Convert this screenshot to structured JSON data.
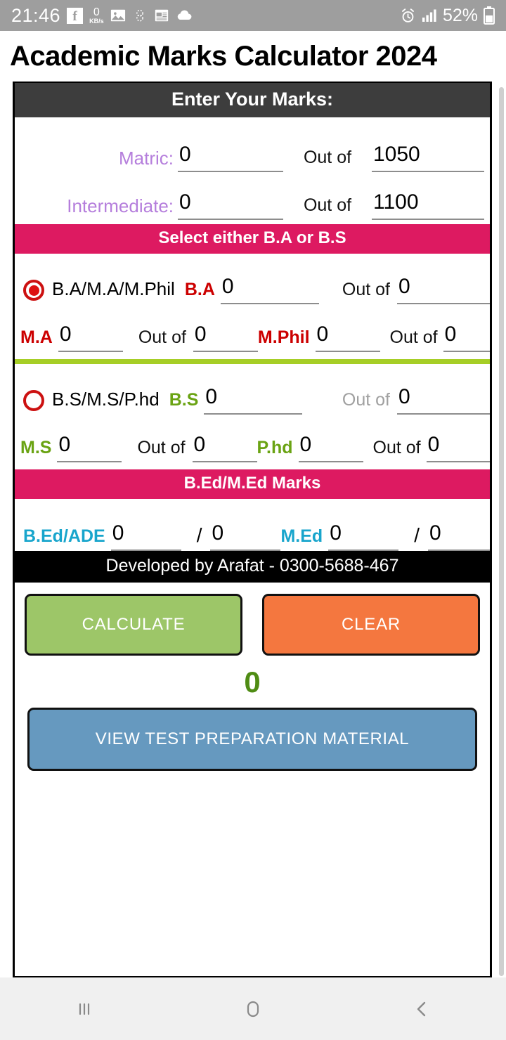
{
  "status_bar": {
    "time": "21:46",
    "data_speed_value": "0",
    "data_speed_unit": "KB/s",
    "battery_percent": "52%",
    "icons": [
      "facebook-icon",
      "data-speed-icon",
      "gallery-icon",
      "circle-app-icon",
      "news-icon",
      "cloud-icon",
      "alarm-icon",
      "signal-icon",
      "battery-icon"
    ]
  },
  "app": {
    "title": "Academic Marks Calculator 2024"
  },
  "marks_section": {
    "header": "Enter Your Marks:",
    "rows": [
      {
        "label": "Matric:",
        "obtained": "0",
        "out_of_label": "Out of",
        "total": "1050"
      },
      {
        "label": "Intermediate:",
        "obtained": "0",
        "out_of_label": "Out of",
        "total": "1100"
      }
    ]
  },
  "degree_section": {
    "header": "Select either B.A or B.S",
    "arts": {
      "selected": true,
      "option_label": "B.A/M.A/M.Phil",
      "primary": {
        "tag": "B.A",
        "obtained": "0",
        "out_of_label": "Out of",
        "total": "0"
      },
      "second": {
        "tag": "M.A",
        "obtained": "0",
        "out_of_label": "Out of",
        "total": "0"
      },
      "third": {
        "tag": "M.Phil",
        "obtained": "0",
        "out_of_label": "Out of",
        "total": "0"
      }
    },
    "science": {
      "selected": false,
      "option_label": "B.S/M.S/P.hd",
      "primary": {
        "tag": "B.S",
        "obtained": "0",
        "out_of_label": "Out of",
        "total": "0"
      },
      "second": {
        "tag": "M.S",
        "obtained": "0",
        "out_of_label": "Out of",
        "total": "0"
      },
      "third": {
        "tag": "P.hd",
        "obtained": "0",
        "out_of_label": "Out of",
        "total": "0"
      }
    }
  },
  "bed_section": {
    "header": "B.Ed/M.Ed Marks",
    "bed": {
      "tag": "B.Ed/ADE",
      "obtained": "0",
      "separator": "/",
      "total": "0"
    },
    "med": {
      "tag": "M.Ed",
      "obtained": "0",
      "separator": "/",
      "total": "0"
    }
  },
  "credit": {
    "text": "Developed by Arafat - 0300-5688-467"
  },
  "actions": {
    "calculate": "CALCULATE",
    "clear": "CLEAR",
    "result": "0",
    "view_material": "VIEW TEST PREPARATION MATERIAL"
  },
  "nav": {
    "recents": "|||",
    "home": "home-icon",
    "back": "back-icon"
  },
  "colors": {
    "pink_header": "#dd1a61",
    "dark_header": "#3d3d3d",
    "divider_green": "#a6ce26",
    "arts_accent": "#cc0000",
    "science_accent": "#6aa313",
    "bed_accent": "#18a5cc",
    "calculate": "#9dc668",
    "clear": "#f4773f",
    "view": "#6699bf",
    "result": "#4f8c14",
    "label_purple": "#b57edc"
  }
}
